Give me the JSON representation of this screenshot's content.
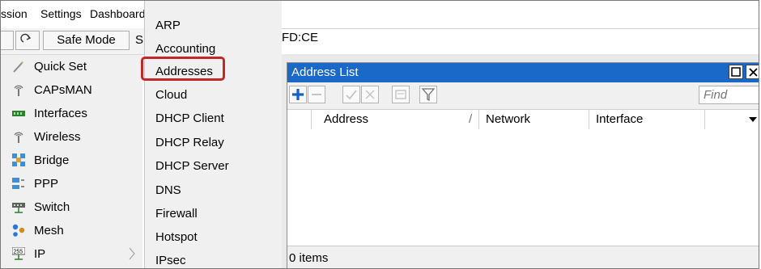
{
  "menubar": {
    "items": [
      "ssion",
      "Settings",
      "Dashboard"
    ]
  },
  "toolbar": {
    "undo_icon": "undo-icon",
    "redo_icon": "redo-icon",
    "safe_mode_label": "Safe Mode",
    "cut_label": "S",
    "identity_fragment": "FD:CE"
  },
  "sidebar": {
    "items": [
      {
        "label": "Quick Set",
        "icon": "wand-icon"
      },
      {
        "label": "CAPsMAN",
        "icon": "antenna-icon"
      },
      {
        "label": "Interfaces",
        "icon": "interfaces-icon"
      },
      {
        "label": "Wireless",
        "icon": "wireless-icon"
      },
      {
        "label": "Bridge",
        "icon": "bridge-icon"
      },
      {
        "label": "PPP",
        "icon": "ppp-icon"
      },
      {
        "label": "Switch",
        "icon": "switch-icon"
      },
      {
        "label": "Mesh",
        "icon": "mesh-icon"
      },
      {
        "label": "IP",
        "icon": "ip-icon",
        "ip_badge": "255"
      }
    ]
  },
  "dropdown": {
    "items": [
      "ARP",
      "Accounting",
      "Addresses",
      "Cloud",
      "DHCP Client",
      "DHCP Relay",
      "DHCP Server",
      "DNS",
      "Firewall",
      "Hotspot",
      "IPsec"
    ],
    "highlighted": "Addresses"
  },
  "address_window": {
    "title": "Address List",
    "find_placeholder": "Find",
    "columns": [
      "Address",
      "Network",
      "Interface"
    ],
    "sort_marker": "/",
    "status": "0 items"
  },
  "colors": {
    "title_bar": "#1a69c8",
    "highlight": "#c0282a",
    "add_icon": "#1560c8"
  }
}
